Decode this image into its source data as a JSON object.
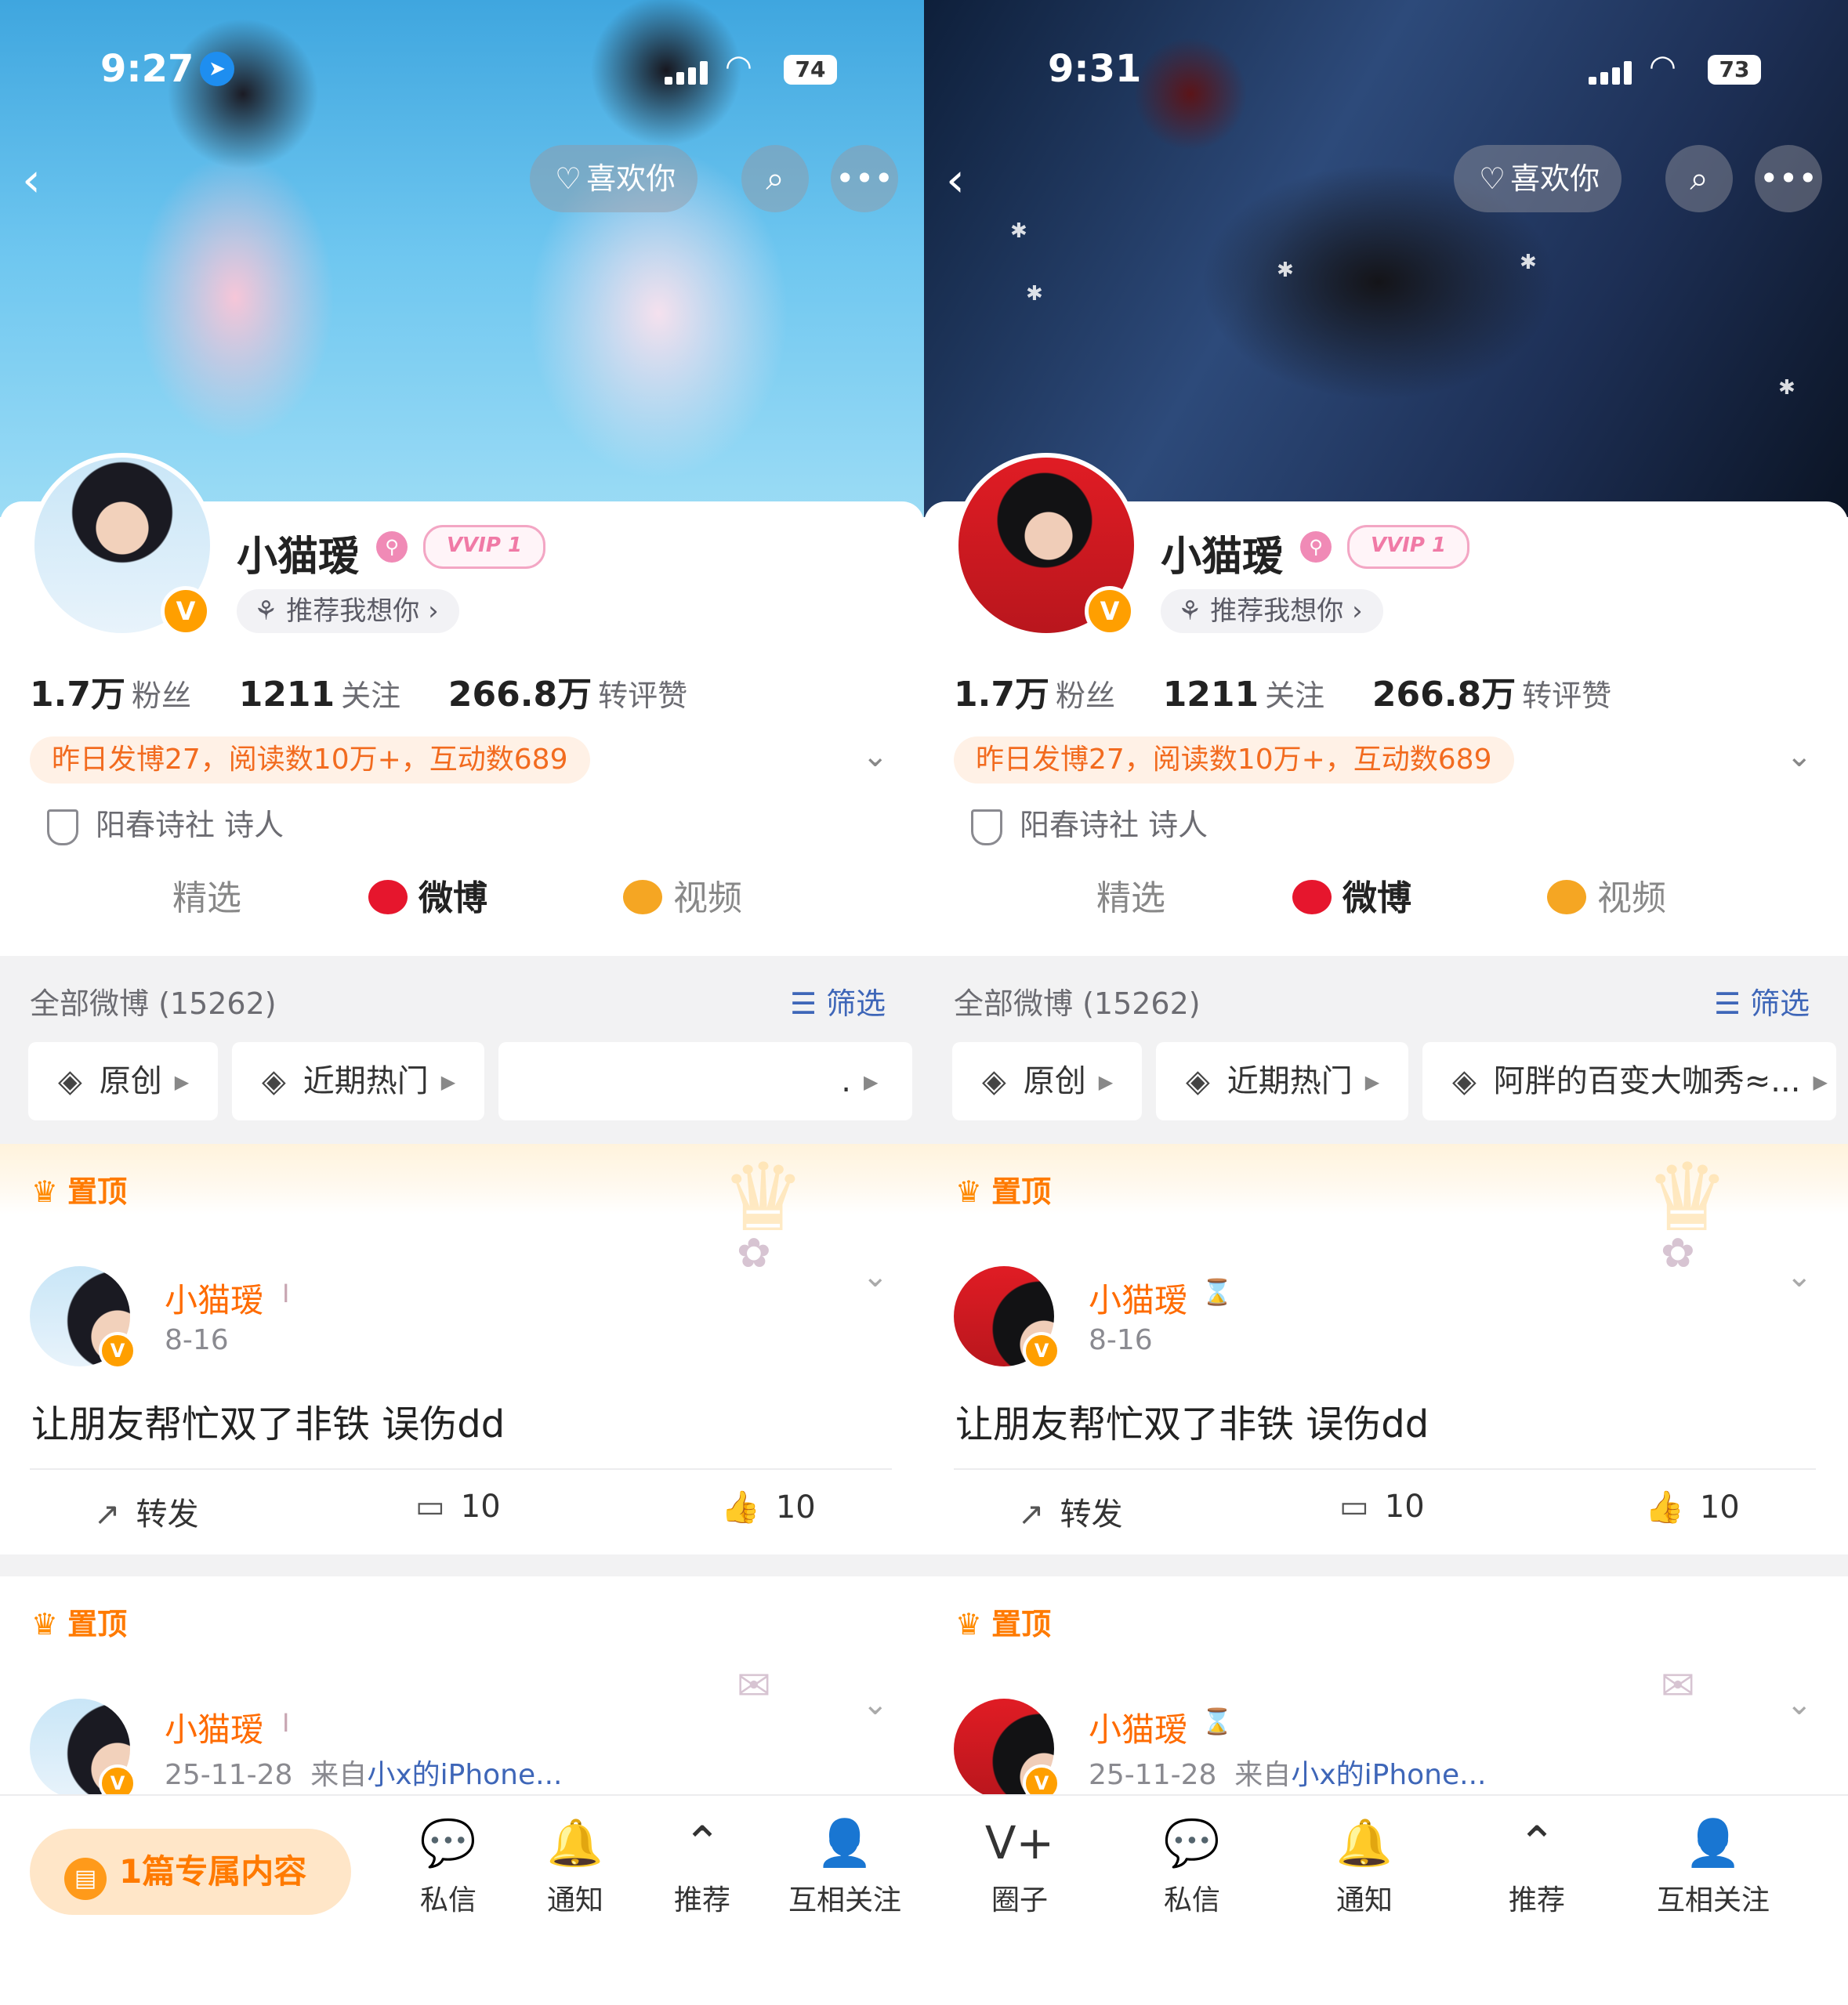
{
  "panels": [
    {
      "status": {
        "time": "9:27",
        "battery": "74",
        "location_icon": "location-arrow-icon"
      },
      "header": {
        "like_button": "喜欢你"
      },
      "profile": {
        "name": "小猫瑷",
        "vip": "VVIP 1",
        "recommend": "推荐我想你",
        "stats": {
          "fans": "1.7万",
          "fans_label": "粉丝",
          "following": "1211",
          "following_label": "关注",
          "interactions": "266.8万",
          "interactions_label": "转评赞"
        },
        "hot": "昨日发博27，阅读数10万+，互动数689",
        "identity": "阳春诗社 诗人"
      },
      "tabs": [
        "精选",
        "微博",
        "视频"
      ],
      "filter": {
        "all": "全部微博 (15262)",
        "filter_label": "筛选",
        "chips": [
          "原创",
          "近期热门",
          "."
        ]
      },
      "pinned_label": "置顶",
      "post1": {
        "name": "小猫瑷",
        "badge": "I",
        "date": "8-16",
        "text": "让朋友帮忙双了非铁 误伤dd",
        "repost": "转发",
        "comments": "10",
        "likes": "10"
      },
      "post2": {
        "name": "小猫瑷",
        "badge": "I",
        "date": "25-11-28",
        "source_prefix": "来自",
        "device": "小x的iPhone..."
      },
      "bottom": {
        "exclusive": "1篇专属内容",
        "nav": [
          "私信",
          "通知",
          "推荐",
          "互相关注"
        ]
      }
    },
    {
      "status": {
        "time": "9:31",
        "battery": "73"
      },
      "header": {
        "like_button": "喜欢你"
      },
      "profile": {
        "name": "小猫瑷",
        "vip": "VVIP 1",
        "recommend": "推荐我想你",
        "stats": {
          "fans": "1.7万",
          "fans_label": "粉丝",
          "following": "1211",
          "following_label": "关注",
          "interactions": "266.8万",
          "interactions_label": "转评赞"
        },
        "hot": "昨日发博27，阅读数10万+，互动数689",
        "identity": "阳春诗社 诗人"
      },
      "tabs": [
        "精选",
        "微博",
        "视频"
      ],
      "filter": {
        "all": "全部微博 (15262)",
        "filter_label": "筛选",
        "chips": [
          "原创",
          "近期热门",
          "阿胖的百变大咖秀≈..."
        ]
      },
      "pinned_label": "置顶",
      "post1": {
        "name": "小猫瑷",
        "badge": "⌛",
        "date": "8-16",
        "text": "让朋友帮忙双了非铁 误伤dd",
        "repost": "转发",
        "comments": "10",
        "likes": "10"
      },
      "post2": {
        "name": "小猫瑷",
        "badge": "⌛",
        "date": "25-11-28",
        "source_prefix": "来自",
        "device": "小x的iPhone..."
      },
      "bottom": {
        "nav": [
          "圈子",
          "私信",
          "通知",
          "推荐",
          "互相关注"
        ]
      }
    }
  ]
}
